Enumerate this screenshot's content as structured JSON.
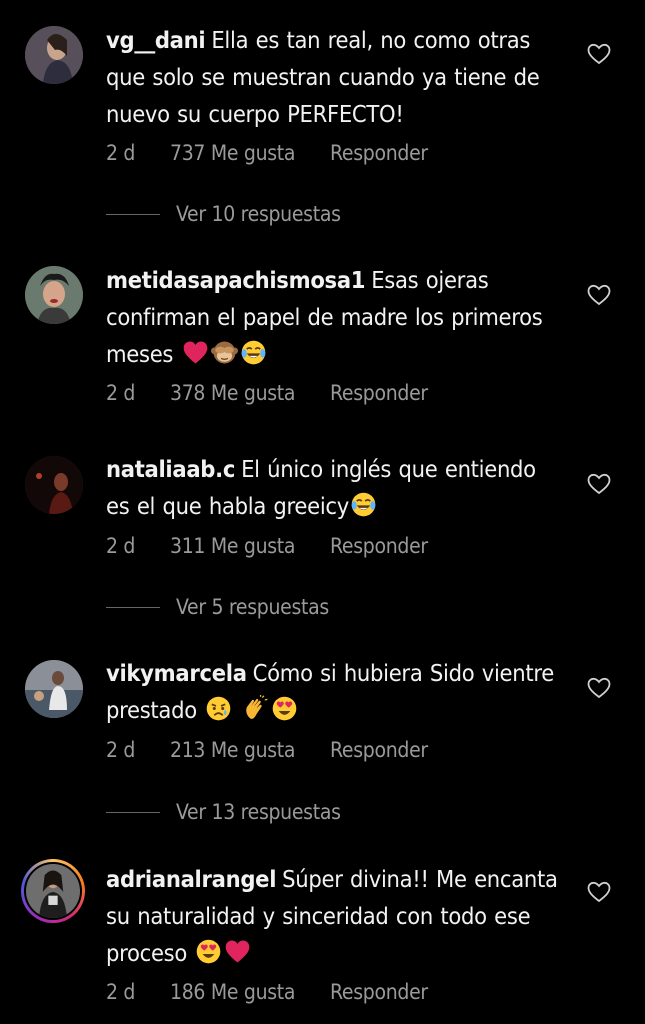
{
  "comments": [
    {
      "username": "vg__dani",
      "text": "Ella es tan real, no como otras que solo se muestran cuando ya tiene de nuevo su cuerpo PERFECTO!",
      "time": "2 d",
      "likes": "737 Me gusta",
      "reply_label": "Responder",
      "view_replies": "Ver 10 respuestas"
    },
    {
      "username": "metidasapachismosa1",
      "text": "Esas ojeras confirman el papel de madre los primeros meses",
      "emojis": [
        "red-heart",
        "see-no-evil-monkey",
        "tears-of-joy"
      ],
      "time": "2 d",
      "likes": "378 Me gusta",
      "reply_label": "Responder"
    },
    {
      "username": "nataliaab.c",
      "text": "El único inglés que entiendo es el que habla greeicy",
      "emojis": [
        "tears-of-joy"
      ],
      "time": "2 d",
      "likes": "311 Me gusta",
      "reply_label": "Responder",
      "view_replies": "Ver 5 respuestas"
    },
    {
      "username": "vikymarcela",
      "text": "Cómo si hubiera Sido vientre prestado",
      "emojis": [
        "sad-but-relieved",
        "clapping-hands",
        "heart-eyes"
      ],
      "time": "2 d",
      "likes": "213 Me gusta",
      "reply_label": "Responder",
      "view_replies": "Ver 13 respuestas"
    },
    {
      "username": "adrianalrangel",
      "text": "Súper divina!! Me encanta su naturalidad y sinceridad con todo ese proceso",
      "emojis": [
        "heart-eyes",
        "red-heart"
      ],
      "time": "2 d",
      "likes": "186 Me gusta",
      "reply_label": "Responder"
    }
  ],
  "icons": {
    "like": "heart-outline-icon"
  },
  "colors": {
    "background": "#000000",
    "text": "#f2f2f2",
    "muted": "#9a9a9a",
    "heart": "#e0245e",
    "emoji_yellow": "#ffcc33"
  }
}
